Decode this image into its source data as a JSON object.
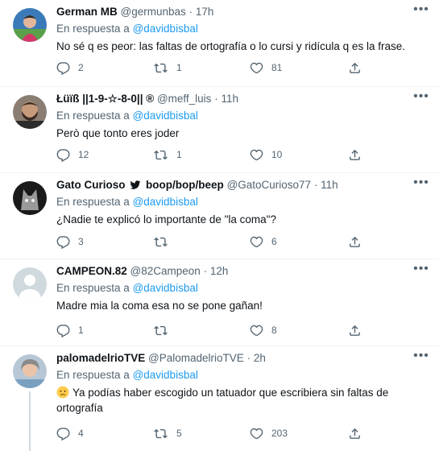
{
  "tweets": [
    {
      "name": "German MB",
      "handle": "@germunbas",
      "sep": "·",
      "time": "17h",
      "reply_prefix": "En respuesta a",
      "reply_to": "@davidbisbal",
      "text": "No sé q es peor: las faltas de ortografía o lo cursi y ridícula q es la frase.",
      "replies": "2",
      "retweets": "1",
      "likes": "81"
    },
    {
      "name": "Łüïß ||1-9-☆-8-0|| ®",
      "handle": "@meff_luis",
      "sep": "·",
      "time": "11h",
      "reply_prefix": "En respuesta a",
      "reply_to": "@davidbisbal",
      "text": "Però que tonto eres joder",
      "replies": "12",
      "retweets": "1",
      "likes": "10"
    },
    {
      "name": "Gato Curioso",
      "name_suffix": "boop/bop/beep",
      "handle": "@GatoCurioso77",
      "sep": "·",
      "time": "11h",
      "reply_prefix": "En respuesta a",
      "reply_to": "@davidbisbal",
      "text": "¿Nadie te explicó lo importante de \"la coma\"?",
      "replies": "3",
      "retweets": "",
      "likes": "6"
    },
    {
      "name": "CAMPEON.82",
      "handle": "@82Campeon",
      "sep": "·",
      "time": "12h",
      "reply_prefix": "En respuesta a",
      "reply_to": "@davidbisbal",
      "text": "Madre mia la coma esa no se pone gañan!",
      "replies": "1",
      "retweets": "",
      "likes": "8"
    },
    {
      "name": "palomadelrioTVE",
      "handle": "@PalomadelrioTVE",
      "sep": "·",
      "time": "2h",
      "reply_prefix": "En respuesta a",
      "reply_to": "@davidbisbal",
      "text": "Ya podías haber escogido un tatuador que escribiera sin faltas de ortografía",
      "replies": "4",
      "retweets": "5",
      "likes": "203"
    }
  ],
  "icons": {
    "more": "more-icon",
    "reply": "reply-icon",
    "retweet": "retweet-icon",
    "like": "heart-icon",
    "share": "share-icon",
    "twitter_bird": "twitter-bird-icon",
    "emoji": "worried-face-emoji"
  },
  "colors": {
    "text": "#0f1419",
    "secondary": "#536471",
    "link": "#1d9bf0",
    "divider": "#eff3f4"
  }
}
